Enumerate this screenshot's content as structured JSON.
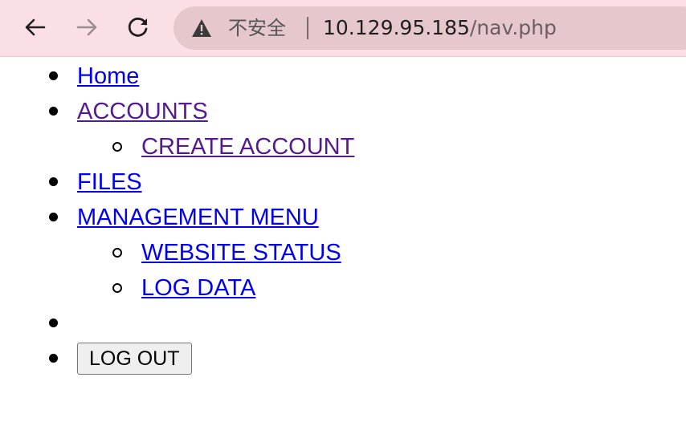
{
  "browser": {
    "security_label": "不安全",
    "url_host": "10.129.95.185",
    "url_path": "/nav.php",
    "icons": {
      "back": "arrow-left-icon",
      "forward": "arrow-right-icon",
      "reload": "reload-icon",
      "security": "warning-triangle-icon"
    }
  },
  "menu": {
    "home": "Home",
    "accounts": "ACCOUNTS",
    "create_account": "CREATE ACCOUNT",
    "files": "FILES",
    "management_menu": "MANAGEMENT MENU",
    "website_status": "WEBSITE STATUS",
    "log_data": "LOG DATA",
    "logout_button": "LOG OUT"
  },
  "colors": {
    "link": "#0000ee",
    "visited_link": "#551a8b",
    "toolbar_bg": "#fadfe4",
    "omnibox_bg": "#e6c7cc"
  }
}
